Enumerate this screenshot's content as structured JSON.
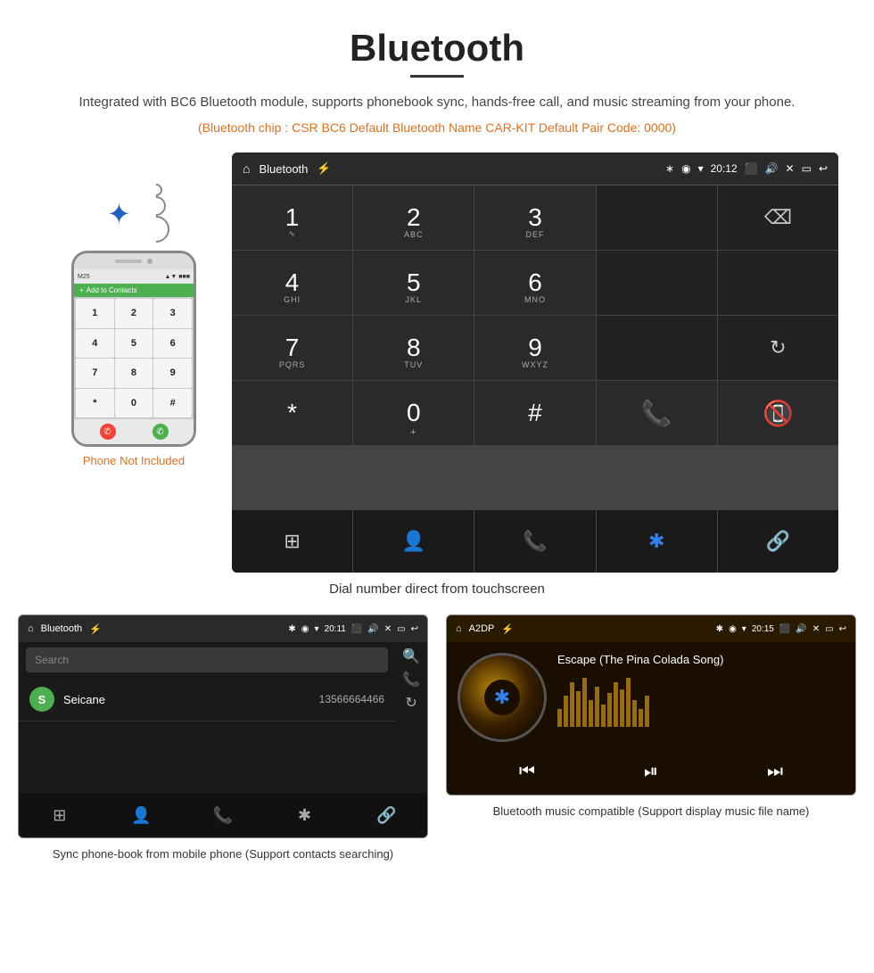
{
  "page": {
    "title": "Bluetooth",
    "subtitle": "Integrated with BC6 Bluetooth module, supports phonebook sync, hands-free call, and music streaming from your phone.",
    "specs": "(Bluetooth chip : CSR BC6    Default Bluetooth Name CAR-KIT    Default Pair Code: 0000)",
    "dial_caption": "Dial number direct from touchscreen",
    "phone_not_included": "Phone Not Included"
  },
  "android_bar": {
    "app_name": "Bluetooth",
    "time": "20:12"
  },
  "dialpad": {
    "keys": [
      {
        "num": "1",
        "sub": ""
      },
      {
        "num": "2",
        "sub": "ABC"
      },
      {
        "num": "3",
        "sub": "DEF"
      },
      {
        "num": "",
        "sub": ""
      },
      {
        "num": "",
        "sub": ""
      },
      {
        "num": "4",
        "sub": "GHI"
      },
      {
        "num": "5",
        "sub": "JKL"
      },
      {
        "num": "6",
        "sub": "MNO"
      },
      {
        "num": "",
        "sub": ""
      },
      {
        "num": "",
        "sub": ""
      },
      {
        "num": "7",
        "sub": "PQRS"
      },
      {
        "num": "8",
        "sub": "TUV"
      },
      {
        "num": "9",
        "sub": "WXYZ"
      },
      {
        "num": "",
        "sub": ""
      },
      {
        "num": "",
        "sub": ""
      },
      {
        "num": "*",
        "sub": ""
      },
      {
        "num": "0",
        "sub": "+"
      },
      {
        "num": "#",
        "sub": ""
      },
      {
        "num": "call",
        "sub": ""
      },
      {
        "num": "hangup",
        "sub": ""
      }
    ]
  },
  "phonebook": {
    "top_bar_app": "Bluetooth",
    "time": "20:11",
    "search_placeholder": "Search",
    "contact_name": "Seicane",
    "contact_phone": "13566664466",
    "contact_initial": "S"
  },
  "music": {
    "top_bar_app": "A2DP",
    "time": "20:15",
    "song_title": "Escape (The Pina Colada Song)"
  },
  "bottom_left_caption": "Sync phone-book from mobile phone\n(Support contacts searching)",
  "bottom_right_caption": "Bluetooth music compatible\n(Support display music file name)"
}
